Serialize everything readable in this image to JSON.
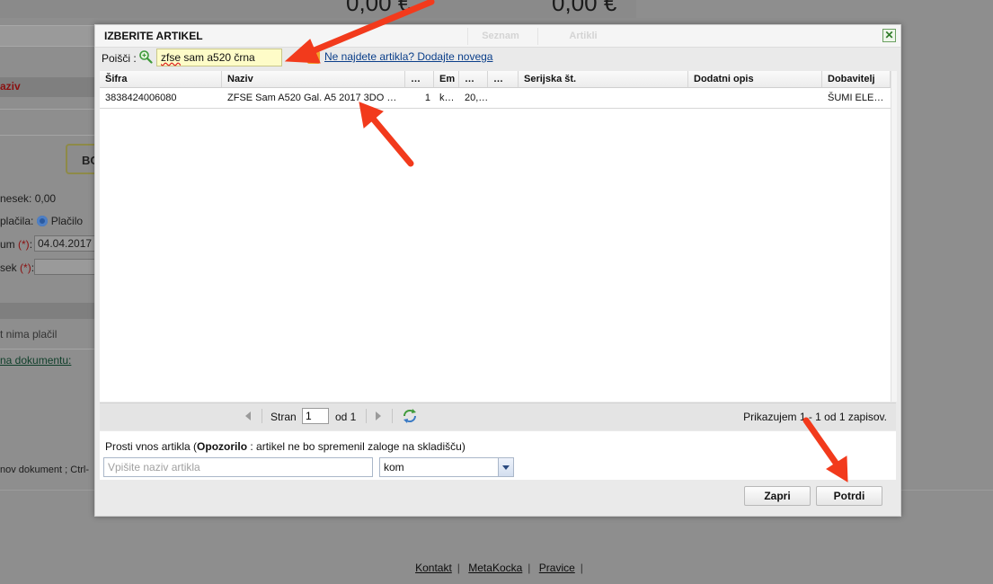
{
  "background": {
    "sum_left": "0,00 €",
    "sum_right": "0,00 €",
    "section_label": "aziv",
    "box_label": "BO",
    "znesek_label": "nesek:",
    "znesek_value": "0,00",
    "placila_label": "plačila:",
    "placilo_option": "Plačilo",
    "datum_label": "um",
    "datum_value": "04.04.2017",
    "znesek2_label": "sek",
    "required_mark": "(*)",
    "colon": ":",
    "no_payments": "t nima plačil",
    "doc_link": "na dokumentu:",
    "shortcut_text": "nov dokument ;  Ctrl-"
  },
  "footer": {
    "links": [
      "Kontakt",
      "MetaKocka",
      "Pravice"
    ],
    "separator": "|"
  },
  "dialog": {
    "title": "IZBERITE ARTIKEL",
    "tabs": [
      "Seznam",
      "Artikli"
    ],
    "close_symbol": "✕",
    "search": {
      "label": "Poišči :",
      "value_word": "zfse",
      "value_rest": " sam a520 črna"
    },
    "new_item_link": "Ne najdete artikla? Dodajte novega",
    "grid": {
      "headers": [
        "Šifra",
        "Naziv",
        "…",
        "Em",
        "…",
        "…",
        "Serijska št.",
        "Dodatni opis",
        "Dobavitelj"
      ],
      "rows": [
        {
          "sifra": "3838424006080",
          "naziv": "ZFSE Sam A520 Gal. A5 2017 3DO …",
          "kol": "1",
          "em": "k…",
          "cena": "20,…",
          "col6": "",
          "serijska": "",
          "opis": "",
          "dobavitelj": "ŠUMI ELE…"
        }
      ]
    },
    "pager": {
      "page_label": "Stran",
      "page_value": "1",
      "of_label": "od 1",
      "summary": "Prikazujem 1 - 1 od 1 zapisov."
    },
    "quick_entry": {
      "label_prefix": "Prosti vnos artikla (",
      "label_bold": "Opozorilo",
      "label_suffix": " : artikel ne bo spremenil zaloge na skladišču)",
      "placeholder": "Vpišite naziv artikla",
      "unit_value": "kom"
    },
    "buttons": {
      "close": "Zapri",
      "confirm": "Potrdi"
    }
  },
  "colors": {
    "arrow": "#f23a1c",
    "search_bg": "#fefcc8",
    "link": "#0b3f8a"
  },
  "icons": [
    "zoom-search-icon",
    "plus-add-icon",
    "close-icon",
    "refresh-icon",
    "first-page-arrow-icon",
    "next-page-arrow-icon",
    "dropdown-arrow-icon",
    "radio-selected-icon"
  ]
}
